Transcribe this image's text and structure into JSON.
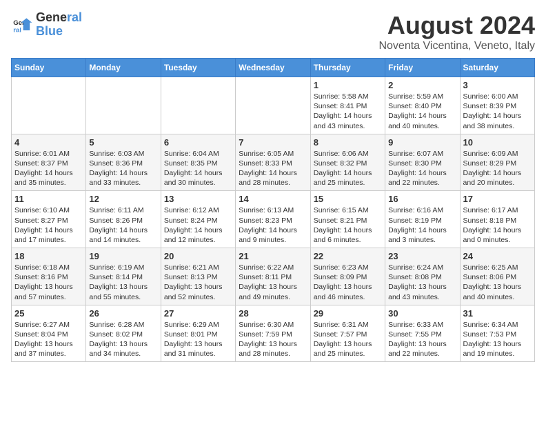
{
  "header": {
    "logo_line1": "General",
    "logo_line2": "Blue",
    "month_title": "August 2024",
    "location": "Noventa Vicentina, Veneto, Italy"
  },
  "weekdays": [
    "Sunday",
    "Monday",
    "Tuesday",
    "Wednesday",
    "Thursday",
    "Friday",
    "Saturday"
  ],
  "weeks": [
    [
      {
        "day": "",
        "info": ""
      },
      {
        "day": "",
        "info": ""
      },
      {
        "day": "",
        "info": ""
      },
      {
        "day": "",
        "info": ""
      },
      {
        "day": "1",
        "info": "Sunrise: 5:58 AM\nSunset: 8:41 PM\nDaylight: 14 hours and 43 minutes."
      },
      {
        "day": "2",
        "info": "Sunrise: 5:59 AM\nSunset: 8:40 PM\nDaylight: 14 hours and 40 minutes."
      },
      {
        "day": "3",
        "info": "Sunrise: 6:00 AM\nSunset: 8:39 PM\nDaylight: 14 hours and 38 minutes."
      }
    ],
    [
      {
        "day": "4",
        "info": "Sunrise: 6:01 AM\nSunset: 8:37 PM\nDaylight: 14 hours and 35 minutes."
      },
      {
        "day": "5",
        "info": "Sunrise: 6:03 AM\nSunset: 8:36 PM\nDaylight: 14 hours and 33 minutes."
      },
      {
        "day": "6",
        "info": "Sunrise: 6:04 AM\nSunset: 8:35 PM\nDaylight: 14 hours and 30 minutes."
      },
      {
        "day": "7",
        "info": "Sunrise: 6:05 AM\nSunset: 8:33 PM\nDaylight: 14 hours and 28 minutes."
      },
      {
        "day": "8",
        "info": "Sunrise: 6:06 AM\nSunset: 8:32 PM\nDaylight: 14 hours and 25 minutes."
      },
      {
        "day": "9",
        "info": "Sunrise: 6:07 AM\nSunset: 8:30 PM\nDaylight: 14 hours and 22 minutes."
      },
      {
        "day": "10",
        "info": "Sunrise: 6:09 AM\nSunset: 8:29 PM\nDaylight: 14 hours and 20 minutes."
      }
    ],
    [
      {
        "day": "11",
        "info": "Sunrise: 6:10 AM\nSunset: 8:27 PM\nDaylight: 14 hours and 17 minutes."
      },
      {
        "day": "12",
        "info": "Sunrise: 6:11 AM\nSunset: 8:26 PM\nDaylight: 14 hours and 14 minutes."
      },
      {
        "day": "13",
        "info": "Sunrise: 6:12 AM\nSunset: 8:24 PM\nDaylight: 14 hours and 12 minutes."
      },
      {
        "day": "14",
        "info": "Sunrise: 6:13 AM\nSunset: 8:23 PM\nDaylight: 14 hours and 9 minutes."
      },
      {
        "day": "15",
        "info": "Sunrise: 6:15 AM\nSunset: 8:21 PM\nDaylight: 14 hours and 6 minutes."
      },
      {
        "day": "16",
        "info": "Sunrise: 6:16 AM\nSunset: 8:19 PM\nDaylight: 14 hours and 3 minutes."
      },
      {
        "day": "17",
        "info": "Sunrise: 6:17 AM\nSunset: 8:18 PM\nDaylight: 14 hours and 0 minutes."
      }
    ],
    [
      {
        "day": "18",
        "info": "Sunrise: 6:18 AM\nSunset: 8:16 PM\nDaylight: 13 hours and 57 minutes."
      },
      {
        "day": "19",
        "info": "Sunrise: 6:19 AM\nSunset: 8:14 PM\nDaylight: 13 hours and 55 minutes."
      },
      {
        "day": "20",
        "info": "Sunrise: 6:21 AM\nSunset: 8:13 PM\nDaylight: 13 hours and 52 minutes."
      },
      {
        "day": "21",
        "info": "Sunrise: 6:22 AM\nSunset: 8:11 PM\nDaylight: 13 hours and 49 minutes."
      },
      {
        "day": "22",
        "info": "Sunrise: 6:23 AM\nSunset: 8:09 PM\nDaylight: 13 hours and 46 minutes."
      },
      {
        "day": "23",
        "info": "Sunrise: 6:24 AM\nSunset: 8:08 PM\nDaylight: 13 hours and 43 minutes."
      },
      {
        "day": "24",
        "info": "Sunrise: 6:25 AM\nSunset: 8:06 PM\nDaylight: 13 hours and 40 minutes."
      }
    ],
    [
      {
        "day": "25",
        "info": "Sunrise: 6:27 AM\nSunset: 8:04 PM\nDaylight: 13 hours and 37 minutes."
      },
      {
        "day": "26",
        "info": "Sunrise: 6:28 AM\nSunset: 8:02 PM\nDaylight: 13 hours and 34 minutes."
      },
      {
        "day": "27",
        "info": "Sunrise: 6:29 AM\nSunset: 8:01 PM\nDaylight: 13 hours and 31 minutes."
      },
      {
        "day": "28",
        "info": "Sunrise: 6:30 AM\nSunset: 7:59 PM\nDaylight: 13 hours and 28 minutes."
      },
      {
        "day": "29",
        "info": "Sunrise: 6:31 AM\nSunset: 7:57 PM\nDaylight: 13 hours and 25 minutes."
      },
      {
        "day": "30",
        "info": "Sunrise: 6:33 AM\nSunset: 7:55 PM\nDaylight: 13 hours and 22 minutes."
      },
      {
        "day": "31",
        "info": "Sunrise: 6:34 AM\nSunset: 7:53 PM\nDaylight: 13 hours and 19 minutes."
      }
    ]
  ]
}
